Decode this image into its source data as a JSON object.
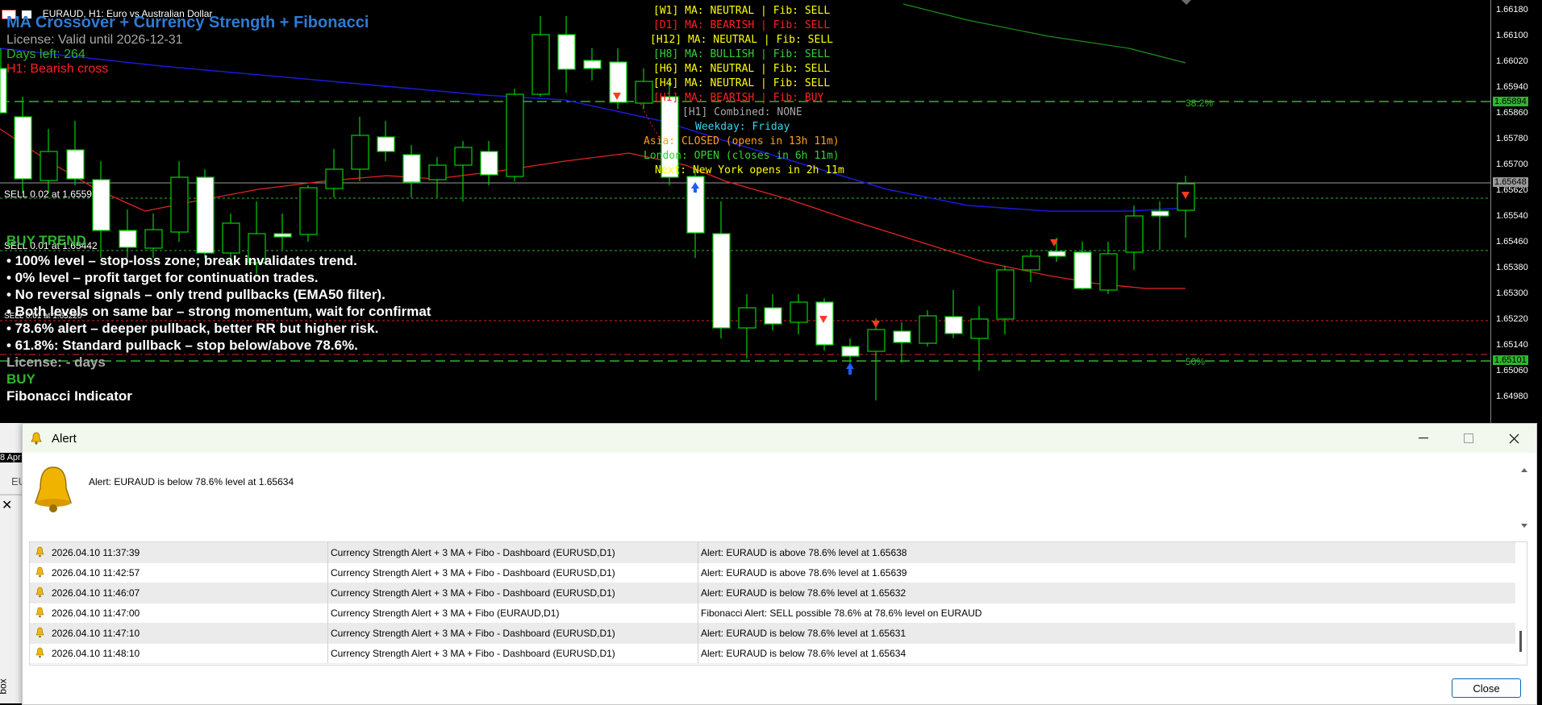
{
  "window": {
    "symbol_title": "EURAUD, H1:  Euro vs Australian Dollar"
  },
  "overlay": {
    "indicator_title": "MA Crossover + Currency Strength + Fibonacci",
    "license": "License: Valid until 2026-12-31",
    "days_left": "Days left: 264",
    "cross_status": "H1: Bearish cross"
  },
  "dashboard": {
    "lines": [
      {
        "text": "[W1] MA: NEUTRAL | Fib: SELL",
        "color": "#ffff00"
      },
      {
        "text": "[D1] MA: BEARISH | Fib: SELL",
        "color": "#ff2020"
      },
      {
        "text": "[H12] MA: NEUTRAL | Fib: SELL",
        "color": "#ffff00"
      },
      {
        "text": "[H8] MA: BULLISH | Fib: SELL",
        "color": "#34d334"
      },
      {
        "text": "[H6] MA: NEUTRAL | Fib: SELL",
        "color": "#ffff00"
      },
      {
        "text": "[H4] MA: NEUTRAL | Fib: SELL",
        "color": "#ffff00"
      },
      {
        "text": "[H1] MA: BEARISH | Fib: BUY",
        "color": "#ff2020"
      },
      {
        "text": "[H1] Combined: NONE",
        "color": "#a8a8a8"
      },
      {
        "text": "Weekday: Friday",
        "color": "#39d4e6"
      },
      {
        "text": "Asia: CLOSED (opens in 13h 11m)",
        "color": "#ff9e1c"
      },
      {
        "text": "London: OPEN (closes in 6h 11m)",
        "color": "#34d334"
      },
      {
        "text": "Next: New York opens in 2h 11m",
        "color": "#ffff00"
      }
    ]
  },
  "chart": {
    "sell_label_1": "SELL 0.02 at 1.6559",
    "sell_label_2": "SELL 0.01 at 1.65442",
    "sell_label_3": "SELL 0.01 at 1.65220",
    "fib_382": "38.2%",
    "fib_50": "50%",
    "price_ticks": [
      "1.66180",
      "1.66100",
      "1.66020",
      "1.65940",
      "1.65860",
      "1.65780",
      "1.65700",
      "1.65620",
      "1.65540",
      "1.65460",
      "1.65380",
      "1.65300",
      "1.65220",
      "1.65140",
      "1.65060",
      "1.64980"
    ],
    "price_tag_high": "1.65894",
    "price_tag_current": "1.65648",
    "price_tag_low": "1.65101",
    "date_fragment": "8 Apr",
    "tab_fragment": "EU"
  },
  "notes": {
    "heading": "BUY TREND",
    "items": [
      "• 100% level – stop-loss zone; break invalidates trend.",
      "• 0% level – profit target for continuation trades.",
      "• No reversal signals – only trend pullbacks (EMA50 filter).",
      "• Both levels on same bar – strong momentum, wait for confirmat",
      "• 78.6% alert – deeper pullback, better RR but higher risk.",
      "• 61.8%: Standard pullback – stop below/above 78.6%."
    ],
    "license_days": "License: - days",
    "signal": "BUY",
    "footer": "Fibonacci Indicator"
  },
  "alert_dialog": {
    "title": "Alert",
    "message": "Alert: EURAUD is below 78.6% level at 1.65634",
    "close_label": "Close",
    "rows": [
      {
        "time": "2026.04.10 11:37:39",
        "source": "Currency Strength Alert + 3 MA + Fibo - Dashboard (EURUSD,D1)",
        "message": "Alert: EURAUD is above 78.6% level at 1.65638"
      },
      {
        "time": "2026.04.10 11:42:57",
        "source": "Currency Strength Alert + 3 MA + Fibo - Dashboard (EURUSD,D1)",
        "message": "Alert: EURAUD is above 78.6% level at 1.65639"
      },
      {
        "time": "2026.04.10 11:46:07",
        "source": "Currency Strength Alert + 3 MA + Fibo - Dashboard (EURUSD,D1)",
        "message": "Alert: EURAUD is below 78.6% level at 1.65632"
      },
      {
        "time": "2026.04.10 11:47:00",
        "source": "Currency Strength Alert + 3 MA + Fibo (EURAUD,D1)",
        "message": "Fibonacci Alert: SELL possible 78.6% at 78.6% level on EURAUD"
      },
      {
        "time": "2026.04.10 11:47:10",
        "source": "Currency Strength Alert + 3 MA + Fibo - Dashboard (EURUSD,D1)",
        "message": "Alert: EURAUD is below 78.6% level at 1.65631"
      },
      {
        "time": "2026.04.10 11:48:10",
        "source": "Currency Strength Alert + 3 MA + Fibo - Dashboard (EURUSD,D1)",
        "message": "Alert: EURAUD is below 78.6% level at 1.65634"
      }
    ]
  },
  "side_panel": {
    "close_glyph": "✕",
    "vertical_label": "box"
  },
  "colors": {
    "fib_line": "#2fb52f",
    "ma_blue": "#1a1ad8",
    "ma_red": "#e52222",
    "ma_green": "#1f8f1f",
    "candle_border": "#00d000",
    "bearish_arrow": "#ff3b1f",
    "bullish_arrow": "#1f5cff"
  }
}
